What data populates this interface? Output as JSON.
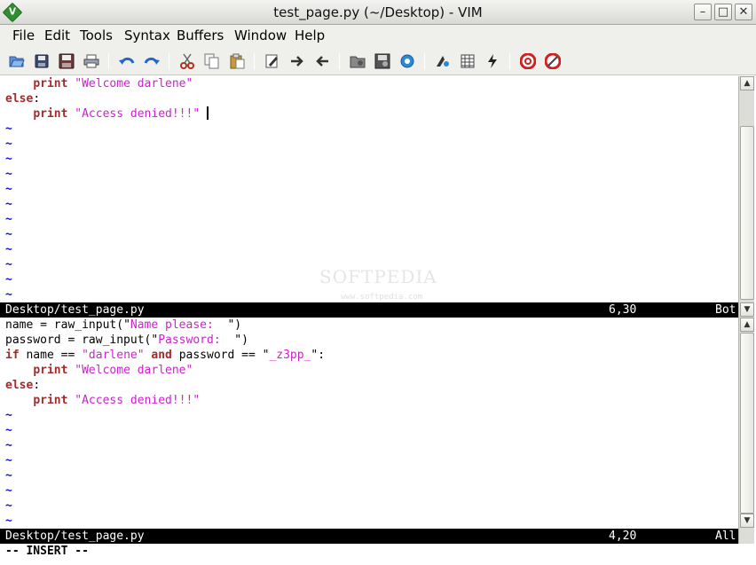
{
  "window": {
    "title": "test_page.py (~/Desktop) - VIM",
    "minimize_glyph": "–",
    "maximize_glyph": "□",
    "close_glyph": "✕"
  },
  "menu": [
    "File",
    "Edit",
    "Tools",
    "Syntax",
    "Buffers",
    "Window",
    "Help"
  ],
  "toolbar": {
    "icons": [
      "open-icon",
      "save-icon",
      "save-all-icon",
      "print-icon",
      "undo-icon",
      "redo-icon",
      "cut-icon",
      "copy-icon",
      "paste-icon",
      "replace-icon",
      "find-next-icon",
      "find-prev-icon",
      "load-session-icon",
      "save-session-icon",
      "run-script-icon",
      "make-icon",
      "build-tags-icon",
      "jump-tag-icon",
      "help-icon",
      "find-help-icon"
    ]
  },
  "top_pane": {
    "line1": {
      "indent": "    ",
      "keyword": "print",
      "space": " ",
      "string": "\"Welcome darlene\""
    },
    "line2": {
      "keyword": "else",
      "punct": ":"
    },
    "line3": {
      "indent": "    ",
      "keyword": "print",
      "space": " ",
      "string": "\"Access denied!!!\"",
      "trail": " "
    },
    "tilde": "~",
    "tilde_count": 12,
    "status": {
      "file": "Desktop/test_page.py",
      "position": "6,30",
      "scroll": "Bot"
    }
  },
  "bottom_pane": {
    "line1": {
      "code": "name = raw_input(",
      "quote_open": "\"",
      "string": "Name please:  ",
      "quote_close": "\"",
      "tail": ")"
    },
    "line2": {
      "code": "password = raw_input(",
      "quote_open": "\"",
      "string": "Password:  ",
      "quote_close": "\"",
      "tail": ")"
    },
    "line3": {
      "kw_if": "if",
      "part1": " name == ",
      "str1": "\"darlene\"",
      "space1": " ",
      "kw_and": "and",
      "part2": " password == ",
      "str2_open": "\"",
      "str2": "_z3pp_",
      "str2_close": "\"",
      "tail": ":"
    },
    "line4": {
      "indent": "    ",
      "keyword": "print",
      "space": " ",
      "string": "\"Welcome darlene\""
    },
    "line5": {
      "keyword": "else",
      "punct": ":"
    },
    "line6": {
      "indent": "    ",
      "keyword": "print",
      "space": " ",
      "string": "\"Access denied!!!\""
    },
    "tilde": "~",
    "tilde_count": 8,
    "status": {
      "file": "Desktop/test_page.py",
      "position": "4,20",
      "scroll": "All"
    }
  },
  "command_line": "-- INSERT --",
  "watermark": {
    "text": "SOFTPEDIA",
    "sub": "www.softpedia.com"
  },
  "colors": {
    "keyword": "#a52a2a",
    "string": "#d020d0",
    "tilde": "#1515d0",
    "status_bg": "#000000",
    "status_fg": "#ffffff"
  }
}
